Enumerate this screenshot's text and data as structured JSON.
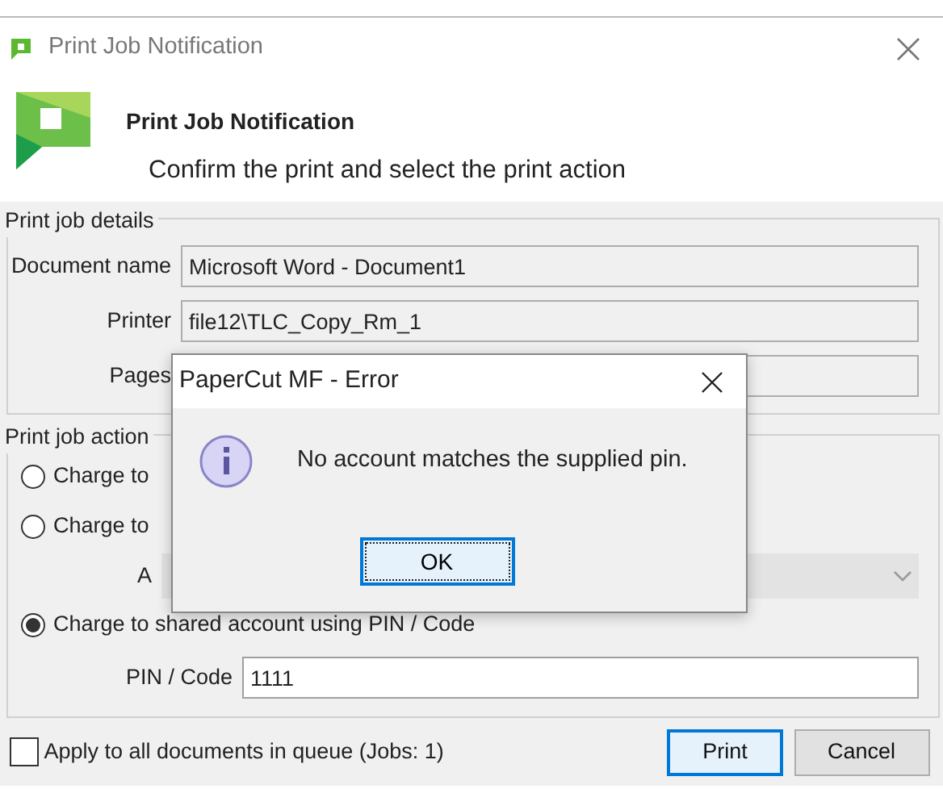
{
  "window": {
    "title": "Print Job Notification"
  },
  "header": {
    "title": "Print Job Notification",
    "subtitle": "Confirm the print and select the print action"
  },
  "details": {
    "legend": "Print job details",
    "fields": [
      {
        "label": "Document name",
        "value": "Microsoft Word - Document1"
      },
      {
        "label": "Printer",
        "value": "file12\\TLC_Copy_Rm_1"
      },
      {
        "label": "Pages"
      }
    ]
  },
  "actions": {
    "legend": "Print job action",
    "options": [
      {
        "label": "Charge to",
        "selected": false
      },
      {
        "label": "Charge to",
        "selected": false
      },
      {
        "label": "Charge to shared account using PIN / Code",
        "selected": true
      }
    ],
    "account_label": "A",
    "pin": {
      "label": "PIN / Code",
      "value": "1111"
    }
  },
  "footer": {
    "apply_all": {
      "label": "Apply to all documents in queue (Jobs: 1)",
      "checked": false
    },
    "buttons": [
      {
        "label": "Print",
        "kind": "default"
      },
      {
        "label": "Cancel",
        "kind": "normal"
      }
    ]
  },
  "error_dialog": {
    "title": "PaperCut MF  - Error",
    "message": "No account matches the supplied pin.",
    "button": "OK"
  }
}
